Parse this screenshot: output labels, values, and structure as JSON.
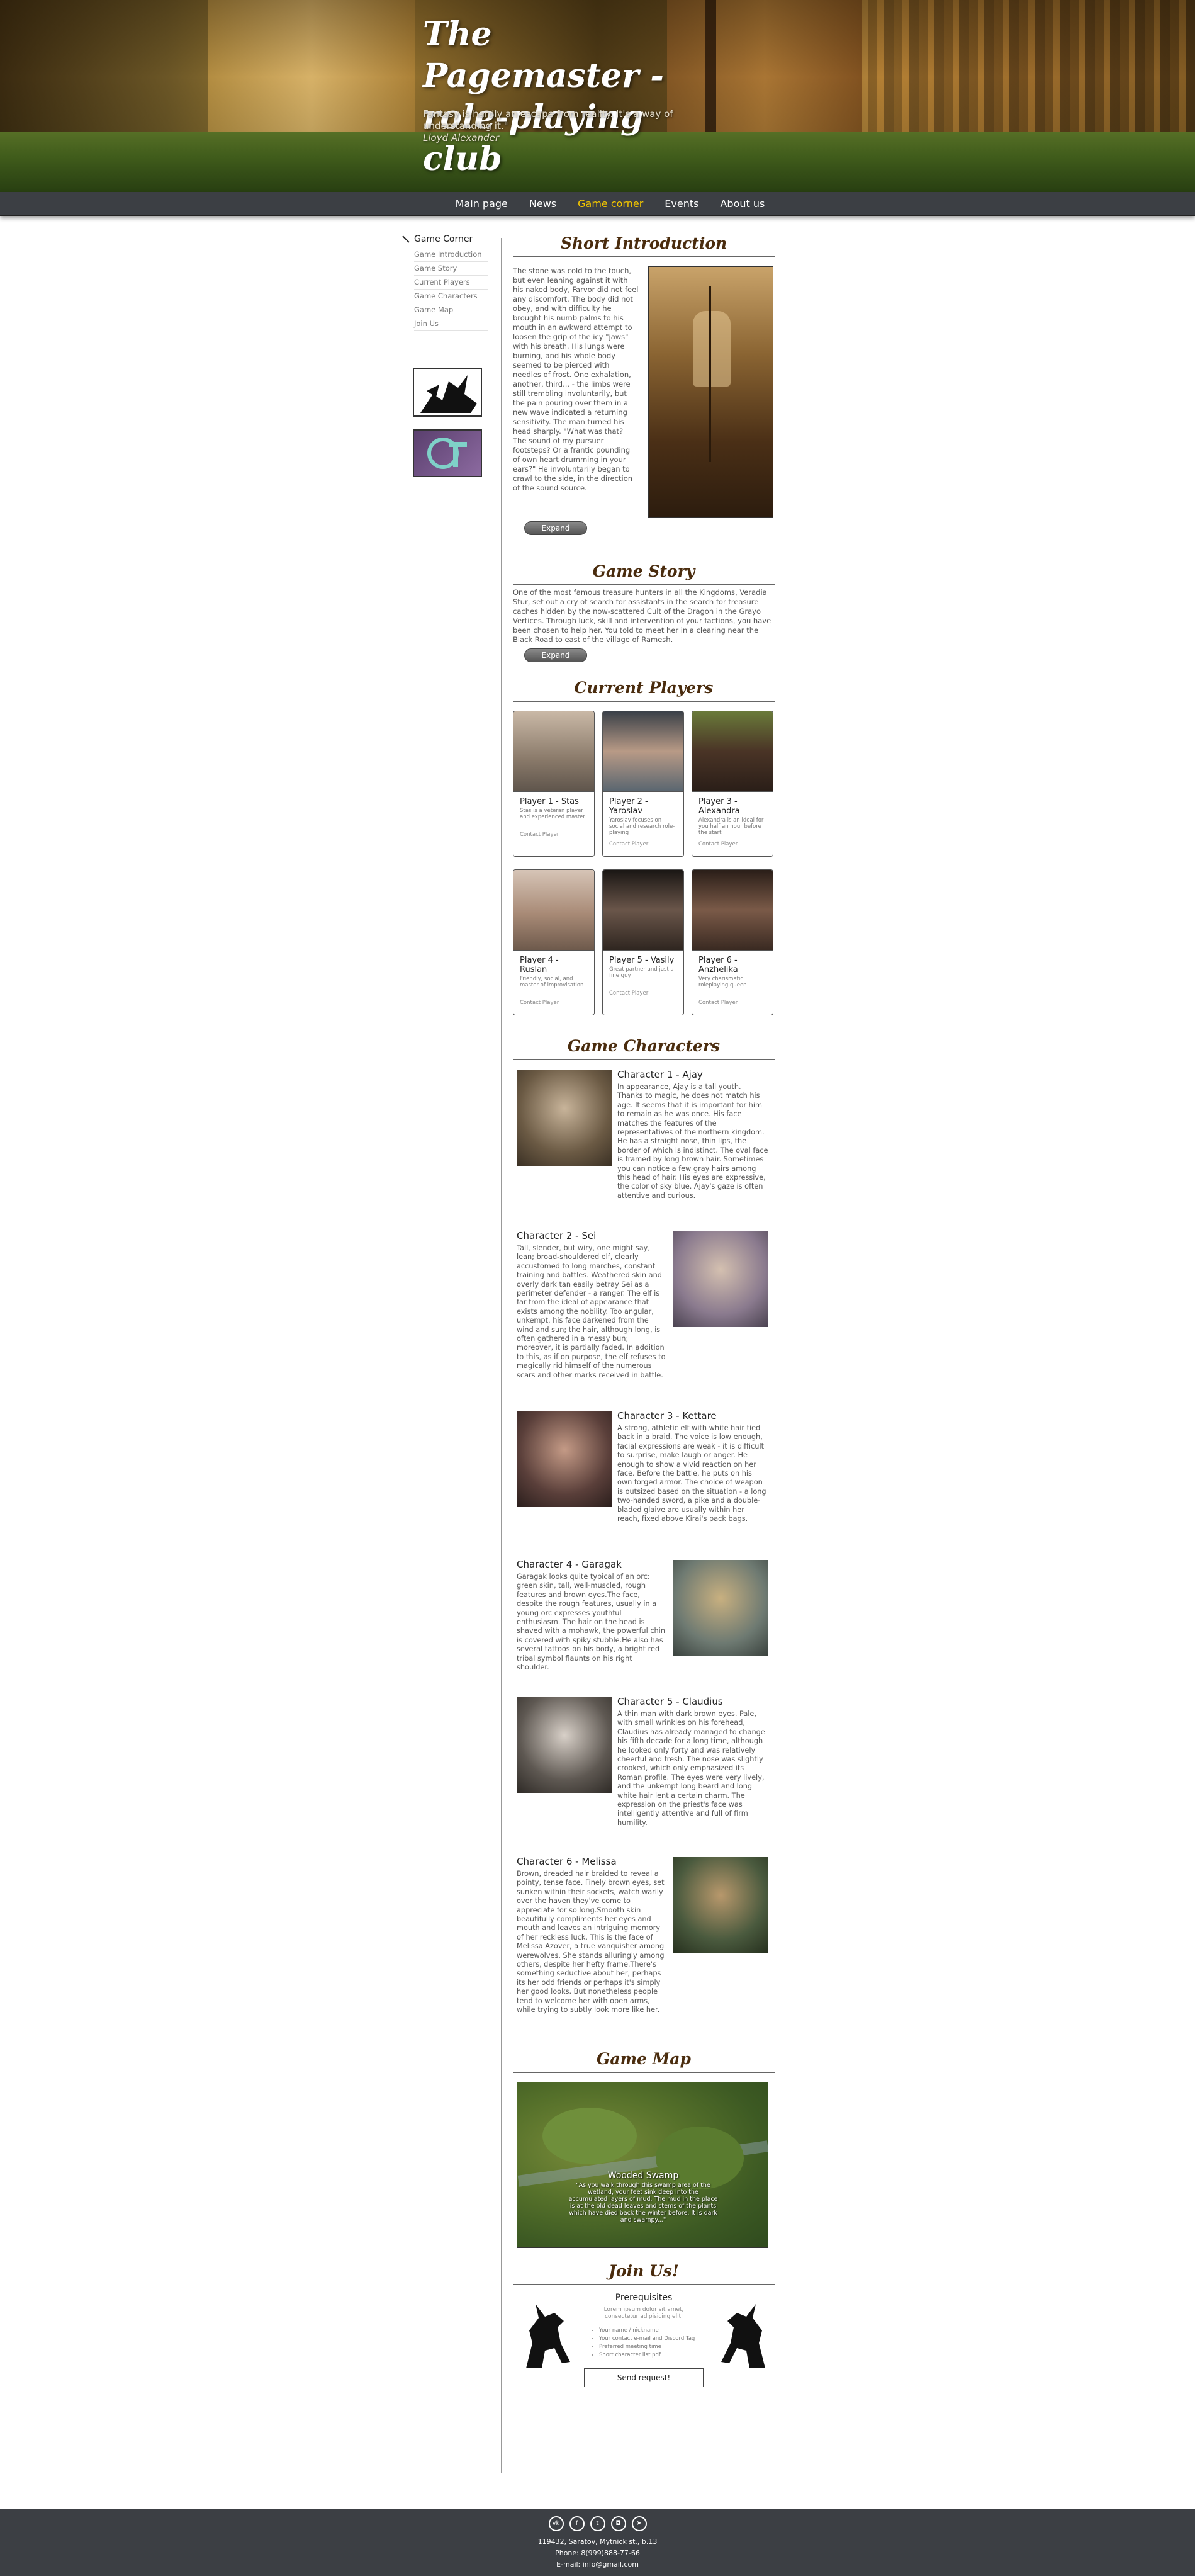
{
  "header": {
    "title": "The Pagemaster - role-playing club",
    "quote": "Fantasy is hardly an escape from reality. It's a way of understanding it.\"",
    "quote_author": "Lloyd Alexander"
  },
  "nav": {
    "items": [
      {
        "label": "Main page"
      },
      {
        "label": "News"
      },
      {
        "label": "Game corner"
      },
      {
        "label": "Events"
      },
      {
        "label": "About us"
      }
    ],
    "active_index": 2
  },
  "sidebar": {
    "title": "Game Corner",
    "items": [
      {
        "label": "Game Introduction"
      },
      {
        "label": "Game Story"
      },
      {
        "label": "Current Players"
      },
      {
        "label": "Game Characters"
      },
      {
        "label": "Game Map"
      },
      {
        "label": "Join Us"
      }
    ]
  },
  "intro": {
    "title": "Short Introduction",
    "text": "The stone was cold to the touch, but even leaning against it with his naked body, Farvor did not feel any discomfort. The body did not obey, and with difficulty he brought his numb palms to his mouth in an awkward attempt to loosen the grip of the icy \"jaws\" with his breath. His lungs were burning, and his whole body seemed to be pierced with needles of frost. One exhalation, another, third... - the limbs were still trembling involuntarily, but the pain pouring over them in a new wave indicated a returning sensitivity. The man turned his head sharply. \"What was that? The sound of my pursuer footsteps? Or a frantic pounding of own heart drumming in your ears?\" He involuntarily began to crawl to the side, in the direction of the sound source.",
    "expand_label": "Expand"
  },
  "story": {
    "title": "Game Story",
    "text": "One of the most famous treasure hunters in all the Kingdoms, Veradia Stur, set out a cry of search for assistants in the search for treasure caches hidden by the now-scattered Cult of the Dragon in the Grayo Vertices. Through luck, skill and intervention of your factions, you have been chosen to help her. You told to meet her in a clearing near the Black Road to east of the village of Ramesh.",
    "expand_label": "Expand"
  },
  "players": {
    "title": "Current Players",
    "contact_label": "Contact Player",
    "items": [
      {
        "name": "Player 1 - Stas",
        "desc": "Stas is a veteran player and experienced master",
        "photo": "#8a7a6a"
      },
      {
        "name": "Player 2 - Yaroslav",
        "desc": "Yaroslav focuses on social and research role-playing",
        "photo": "#5a6670"
      },
      {
        "name": "Player 3 - Alexandra",
        "desc": "Alexandra is an ideal for you half an hour before the start",
        "photo": "#4a3426"
      },
      {
        "name": "Player 4 - Ruslan",
        "desc": "Friendly, social, and master of improvisation",
        "photo": "#a88a76"
      },
      {
        "name": "Player 5 - Vasily",
        "desc": "Great partner and just a fine guy",
        "photo": "#2f2620"
      },
      {
        "name": "Player 6 - Anzhelika",
        "desc": "Very charismatic roleplaying queen",
        "photo": "#3a2a22"
      }
    ]
  },
  "characters": {
    "title": "Game Characters",
    "items": [
      {
        "name": "Character 1 - Ajay",
        "side": "left",
        "img": "#6b5a44",
        "text": "In appearance, Ajay is a tall youth. Thanks to magic, he does not match his age. It seems that it is important for him to remain as he was once. His face matches the features of the representatives of the northern kingdom. He has a straight nose, thin lips, the border of which is indistinct. The oval face is framed by long brown hair. Sometimes you can notice a few gray hairs among this head of hair. His eyes are expressive, the color of sky blue. Ajay's gaze is often attentive and curious."
      },
      {
        "name": "Character 2 - Sei",
        "side": "right",
        "img": "#8a7a8e",
        "text": "Tall, slender, but wiry, one might say, lean; broad-shouldered elf, clearly accustomed to long marches, constant training and battles. Weathered skin and overly dark tan easily betray Sei as a perimeter defender - a ranger. The elf is far from the ideal of appearance that exists among the nobility. Too angular, unkempt, his face darkened from the wind and sun; the hair, although long, is often gathered in a messy bun; moreover, it is partially faded. In addition to this, as if on purpose, the elf refuses to magically rid himself of the numerous scars and other marks received in battle."
      },
      {
        "name": "Character 3 - Kettare",
        "side": "left",
        "img": "#5a3f3a",
        "text": "A strong, athletic elf with white hair tied back in a braid. The voice is low enough, facial expressions are weak - it is difficult to surprise, make laugh or anger. He enough to show a vivid reaction on her face. Before the battle, he puts on his own forged armor. The choice of weapon is outsized based on the situation - a long two-handed sword, a pike and a double-bladed glaive are usually within her reach, fixed above Kirai's pack bags."
      },
      {
        "name": "Character 4 - Garagak",
        "side": "right",
        "img": "#6e7a72",
        "text": "Garagak looks quite typical of an orc: green skin, tall, well-muscled, rough features and brown eyes.The face, despite the rough features, usually in a young orc expresses youthful enthusiasm. The hair on the head is shaved with a mohawk, the powerful chin is covered with spiky stubble.He also has several tattoos on his body, a bright red tribal symbol flaunts on his right shoulder."
      },
      {
        "name": "Character 5 - Claudius",
        "side": "left",
        "img": "#5e5852",
        "text": "A thin man with dark brown eyes. Pale, with small wrinkles on his forehead, Claudius has already managed to change his fifth decade for a long time, although he looked only forty and was relatively cheerful and fresh. The nose was slightly crooked, which only emphasized its Roman profile. The eyes were very lively, and the unkempt long beard and long white hair lent a certain charm. The expression on the priest's face was intelligently attentive and full of firm humility."
      },
      {
        "name": "Character 6 - Melissa",
        "side": "right",
        "img": "#4a5a3e",
        "text": "Brown, dreaded hair braided to reveal a pointy, tense face. Finely brown eyes, set sunken within their sockets, watch warily over the haven they've come to appreciate for so long.Smooth skin beautifully compliments her eyes and mouth and leaves an intriguing memory of her reckless luck. This is the face of Melissa Azover, a true vanquisher among werewolves. She stands alluringly among others, despite her hefty frame.There's something seductive about her, perhaps its her odd friends or perhaps it's simply her good looks. But nonetheless people tend to welcome her with open arms, while trying to subtly look more like her."
      }
    ]
  },
  "map": {
    "title": "Game Map",
    "caption_title": "Wooded Swamp",
    "caption_text": "\"As you walk through this swamp area of the wetland, your feet sink deep into the accumulated layers of mud. The mud in the place is at the old dead leaves and stems of the plants which have died back the winter before. It is dark and swampy...\""
  },
  "join": {
    "title": "Join Us!",
    "subtitle": "Prerequisites",
    "lead": "Lorem ipsum dolor sit amet, consectetur adipisicing elit.",
    "items": [
      "Your name / nickname",
      "Your contact e-mail and Discord Tag",
      "Preferred meeting time",
      "Short character list pdf"
    ],
    "button": "Send request!"
  },
  "footer": {
    "icons": [
      "vk-icon",
      "facebook-icon",
      "twitter-icon",
      "instagram-icon",
      "telegram-icon"
    ],
    "address": "119432, Saratov, Mytnick st., b.13",
    "phone": "Phone: 8(999)888-77-66",
    "email": "E-mail: info@gmail.com"
  },
  "colors": {
    "nav_bg": "#3c3f44",
    "nav_active": "#f2c500",
    "section_title": "#4a2c0e"
  }
}
